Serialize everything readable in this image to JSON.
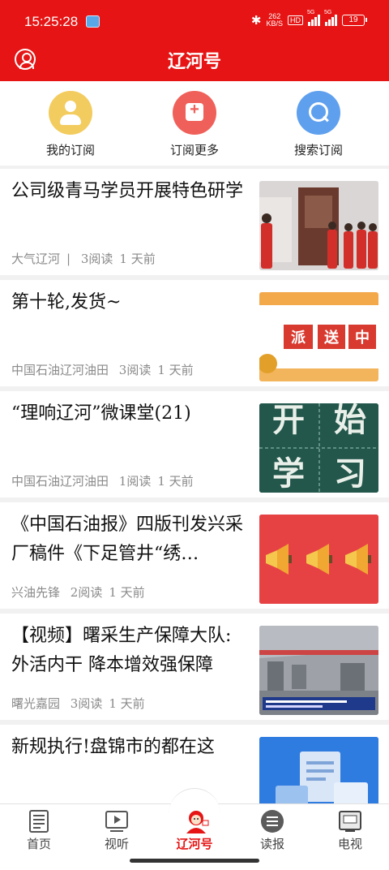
{
  "status_bar": {
    "time": "15:25:28",
    "network_speed_value": "262",
    "network_speed_unit": "KB/S",
    "hd_badge": "HD",
    "sim1_label": "5G",
    "sim2_label": "5G",
    "battery": "19",
    "icons": [
      "app-notification-icon",
      "bluetooth-icon",
      "signal-icon",
      "battery-icon"
    ]
  },
  "header": {
    "title": "辽河号",
    "left_icon": "user-icon",
    "background": "#e61414"
  },
  "shortcuts": [
    {
      "label": "我的订阅",
      "icon": "person-icon",
      "color": "#f3cc5f"
    },
    {
      "label": "订阅更多",
      "icon": "plus-icon",
      "color": "#f0605a"
    },
    {
      "label": "搜索订阅",
      "icon": "search-icon",
      "color": "#5fa0ee"
    }
  ],
  "articles": [
    {
      "title": "公司级青马学员开展特色研学",
      "source": "大气辽河",
      "separator": "|",
      "reads": "3阅读",
      "time": "1 天前",
      "thumb": "study-tour-photo"
    },
    {
      "title": "第十轮,发货~",
      "source": "中国石油辽河油田",
      "reads": "3阅读",
      "time": "1 天前",
      "thumb": "delivery-banner",
      "thumb_text": [
        "派",
        "送",
        "中"
      ]
    },
    {
      "title": "“理响辽河”微课堂(21)",
      "source": "中国石油辽河油田",
      "reads": "1阅读",
      "time": "1 天前",
      "thumb": "chalkboard-study",
      "thumb_text": [
        "开",
        "始",
        "学",
        "习"
      ]
    },
    {
      "title": "《中国石油报》四版刊发兴采厂稿件《下足管井“绣…",
      "source": "兴油先锋",
      "reads": "2阅读",
      "time": "1 天前",
      "thumb": "megaphone-banner"
    },
    {
      "title": "【视频】曙采生产保障大队:外活内干 降本增效强保障",
      "source": "曙光嘉园",
      "reads": "3阅读",
      "time": "1 天前",
      "thumb": "workshop-video-still"
    },
    {
      "title": "新规执行!盘锦市的都在这",
      "source": "",
      "reads": "",
      "time": "",
      "thumb": "document-illustration"
    }
  ],
  "bottom_nav": [
    {
      "label": "首页",
      "icon": "newspaper-icon",
      "active": false
    },
    {
      "label": "视听",
      "icon": "play-icon",
      "active": false
    },
    {
      "label": "辽河号",
      "icon": "mascot-icon",
      "active": true
    },
    {
      "label": "读报",
      "icon": "list-icon",
      "active": false
    },
    {
      "label": "电视",
      "icon": "tv-icon",
      "active": false
    }
  ],
  "colors": {
    "accent": "#e61414",
    "meta_text": "#8a8a8a",
    "feed_background": "#f1f1f1"
  }
}
